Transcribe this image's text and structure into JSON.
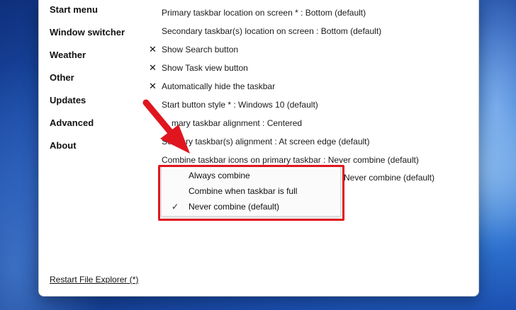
{
  "nav": {
    "items": [
      "Start menu",
      "Window switcher",
      "Weather",
      "Other",
      "Updates",
      "Advanced",
      "About"
    ],
    "restart_link": "Restart File Explorer (*)"
  },
  "settings": {
    "primary_location": "Primary taskbar location on screen * : Bottom (default)",
    "secondary_location": "Secondary taskbar(s) location on screen : Bottom (default)",
    "show_search": "Show Search button",
    "show_task_view": "Show Task view button",
    "auto_hide": "Automatically hide the taskbar",
    "start_button_style": "Start button style * : Windows 10 (default)",
    "primary_alignment_partial": "mary taskbar alignment : Centered",
    "secondary_alignment_partial": "ary taskbar(s) alignment : At screen edge (default)",
    "secondary_alignment_prefix": "Seco",
    "combine_primary": "Combine taskbar icons on primary taskbar : Never combine (default)",
    "combine_secondary_partial": "Never combine (default)",
    "check_glyph": "✕"
  },
  "dropdown": {
    "options": [
      "Always combine",
      "Combine when taskbar is full",
      "Never combine (default)"
    ],
    "selected_check": "✓"
  },
  "colors": {
    "highlight_red": "#e0161f",
    "arrow_red": "#e0161f",
    "wallpaper_blue": "#1b4fb0"
  },
  "icons": [
    "x-check-icon",
    "checkmark-icon",
    "red-arrow-annotation"
  ]
}
